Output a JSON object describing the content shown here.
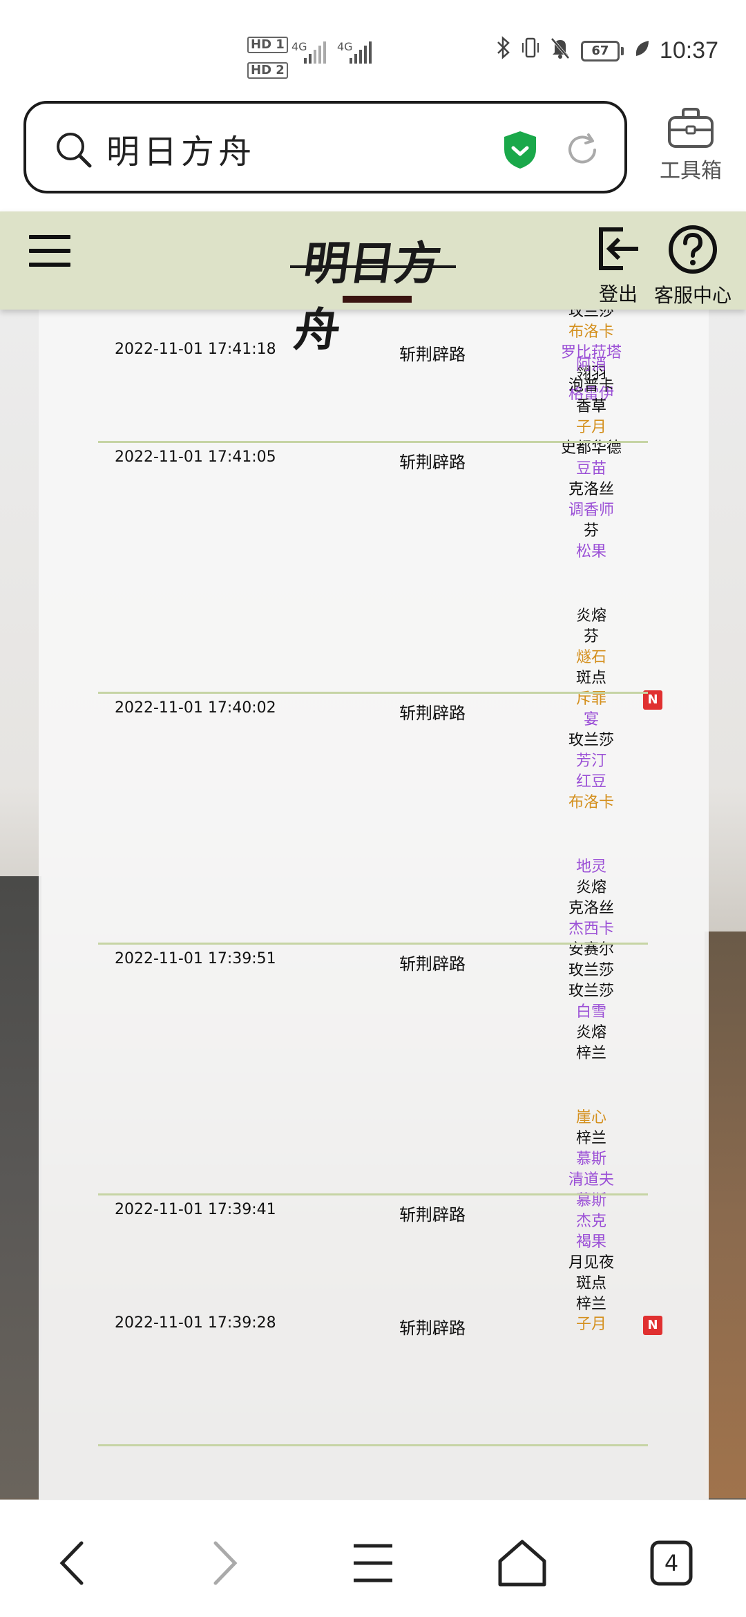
{
  "status_bar": {
    "sim1": "HD 1",
    "sim2": "HD 2",
    "network1": "4G",
    "network2": "4G",
    "battery": "67",
    "time": "10:37"
  },
  "browser": {
    "search_text": "明日方舟",
    "toolbox_label": "工具箱",
    "tab_count": "4"
  },
  "app_header": {
    "logo_text": "明日方舟",
    "logout_label": "登出",
    "help_label": "客服中心"
  },
  "rows": [
    {
      "time": "2022-11-01 17:41:18",
      "pool": "斩荆辟路",
      "operators": [
        {
          "name": "玫兰莎",
          "rarity": 4
        },
        {
          "name": "布洛卡",
          "rarity": 6
        },
        {
          "name": "罗比菈塔",
          "rarity": 5
        },
        {
          "name": "翎羽",
          "rarity": 4
        },
        {
          "name": "格雷伊",
          "rarity": 5
        }
      ]
    },
    {
      "time": "2022-11-01 17:41:05",
      "pool": "斩荆辟路",
      "operators": [
        {
          "name": "阿消",
          "rarity": 5
        },
        {
          "name": "泡普卡",
          "rarity": 4
        },
        {
          "name": "香草",
          "rarity": 4
        },
        {
          "name": "子月",
          "rarity": 6
        },
        {
          "name": "史都华德",
          "rarity": 4
        },
        {
          "name": "豆苗",
          "rarity": 5
        },
        {
          "name": "克洛丝",
          "rarity": 4
        },
        {
          "name": "调香师",
          "rarity": 5
        },
        {
          "name": "芬",
          "rarity": 4
        },
        {
          "name": "松果",
          "rarity": 5
        }
      ]
    },
    {
      "time": "2022-11-01 17:40:02",
      "pool": "斩荆辟路",
      "operators": [
        {
          "name": "炎熔",
          "rarity": 4
        },
        {
          "name": "芬",
          "rarity": 4
        },
        {
          "name": "燧石",
          "rarity": 6
        },
        {
          "name": "斑点",
          "rarity": 4
        },
        {
          "name": "斥罪",
          "rarity": 6,
          "new": "N"
        },
        {
          "name": "宴",
          "rarity": 5
        },
        {
          "name": "玫兰莎",
          "rarity": 4
        },
        {
          "name": "芳汀",
          "rarity": 5
        },
        {
          "name": "红豆",
          "rarity": 5
        },
        {
          "name": "布洛卡",
          "rarity": 6
        }
      ]
    },
    {
      "time": "2022-11-01 17:39:51",
      "pool": "斩荆辟路",
      "operators": [
        {
          "name": "地灵",
          "rarity": 5
        },
        {
          "name": "炎熔",
          "rarity": 4
        },
        {
          "name": "克洛丝",
          "rarity": 4
        },
        {
          "name": "杰西卡",
          "rarity": 5
        },
        {
          "name": "安赛尔",
          "rarity": 4
        },
        {
          "name": "玫兰莎",
          "rarity": 4
        },
        {
          "name": "玫兰莎",
          "rarity": 4
        },
        {
          "name": "白雪",
          "rarity": 5
        },
        {
          "name": "炎熔",
          "rarity": 4
        },
        {
          "name": "梓兰",
          "rarity": 4
        }
      ]
    },
    {
      "time": "2022-11-01 17:39:41",
      "pool": "斩荆辟路",
      "operators": [
        {
          "name": "崖心",
          "rarity": 6
        },
        {
          "name": "梓兰",
          "rarity": 4
        },
        {
          "name": "慕斯",
          "rarity": 5
        },
        {
          "name": "清道夫",
          "rarity": 5
        },
        {
          "name": "慕斯",
          "rarity": 5
        },
        {
          "name": "杰克",
          "rarity": 5
        },
        {
          "name": "褐果",
          "rarity": 5
        },
        {
          "name": "月见夜",
          "rarity": 4
        },
        {
          "name": "斑点",
          "rarity": 4
        },
        {
          "name": "梓兰",
          "rarity": 4
        }
      ]
    },
    {
      "time": "2022-11-01 17:39:28",
      "pool": "斩荆辟路",
      "operators": [
        {
          "name": "子月",
          "rarity": 6,
          "new": "N"
        }
      ]
    }
  ],
  "colors": {
    "rarity4": "#111111",
    "rarity5": "#9b50d6",
    "rarity6": "#d4901e",
    "header_bg": "#dde2c8",
    "divider": "#c6d4a4",
    "shield_green": "#1aa84a",
    "new_badge": "#e03030"
  },
  "icons": {
    "search": "search-icon",
    "shield": "shield-check-icon",
    "reload": "reload-icon",
    "toolbox": "toolbox-icon",
    "menu": "hamburger-menu-icon",
    "logout": "logout-icon",
    "help": "question-circle-icon",
    "back": "back-arrow-icon",
    "forward": "forward-arrow-icon",
    "tabs_menu": "menu-lines-icon",
    "home": "home-icon"
  }
}
